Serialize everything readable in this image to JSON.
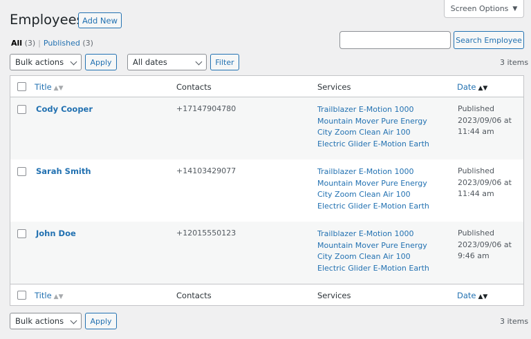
{
  "screen_options": {
    "label": "Screen Options"
  },
  "page": {
    "title": "Employees",
    "add_new_label": "Add New"
  },
  "views": {
    "all_label": "All",
    "all_count": "(3)",
    "separator": "|",
    "published_label": "Published",
    "published_count": "(3)"
  },
  "search": {
    "value": "",
    "button_label": "Search Employee"
  },
  "top_nav": {
    "bulk_actions": "Bulk actions",
    "apply_label": "Apply",
    "date_filter": "All dates",
    "filter_label": "Filter",
    "items_count": "3 items"
  },
  "bottom_nav": {
    "bulk_actions": "Bulk actions",
    "apply_label": "Apply",
    "items_count": "3 items"
  },
  "table": {
    "columns": {
      "title": "Title",
      "contacts": "Contacts",
      "services": "Services",
      "date": "Date"
    },
    "rows": [
      {
        "name": "Cody Cooper",
        "contact": "+17147904780",
        "services": [
          "Trailblazer E-Motion 1000",
          "Mountain Mover Pure Energy",
          "City Zoom Clean Air 100",
          "Electric Glider E-Motion Earth"
        ],
        "status": "Published",
        "date": "2023/09/06 at",
        "time": "11:44 am"
      },
      {
        "name": "Sarah Smith",
        "contact": "+14103429077",
        "services": [
          "Trailblazer E-Motion 1000",
          "Mountain Mover Pure Energy",
          "City Zoom Clean Air 100",
          "Electric Glider E-Motion Earth"
        ],
        "status": "Published",
        "date": "2023/09/06 at",
        "time": "11:44 am"
      },
      {
        "name": "John Doe",
        "contact": "+12015550123",
        "services": [
          "Trailblazer E-Motion 1000",
          "Mountain Mover Pure Energy",
          "City Zoom Clean Air 100",
          "Electric Glider E-Motion Earth"
        ],
        "status": "Published",
        "date": "2023/09/06 at",
        "time": "9:46 am"
      }
    ]
  },
  "icons": {
    "sort_unsorted": "sort-up-down-icon",
    "sort_active": "sort-desc-icon",
    "dropdown": "chevron-down-icon"
  },
  "colors": {
    "accent": "#2271b1",
    "background": "#f0f0f1",
    "border": "#c3c4c7"
  }
}
